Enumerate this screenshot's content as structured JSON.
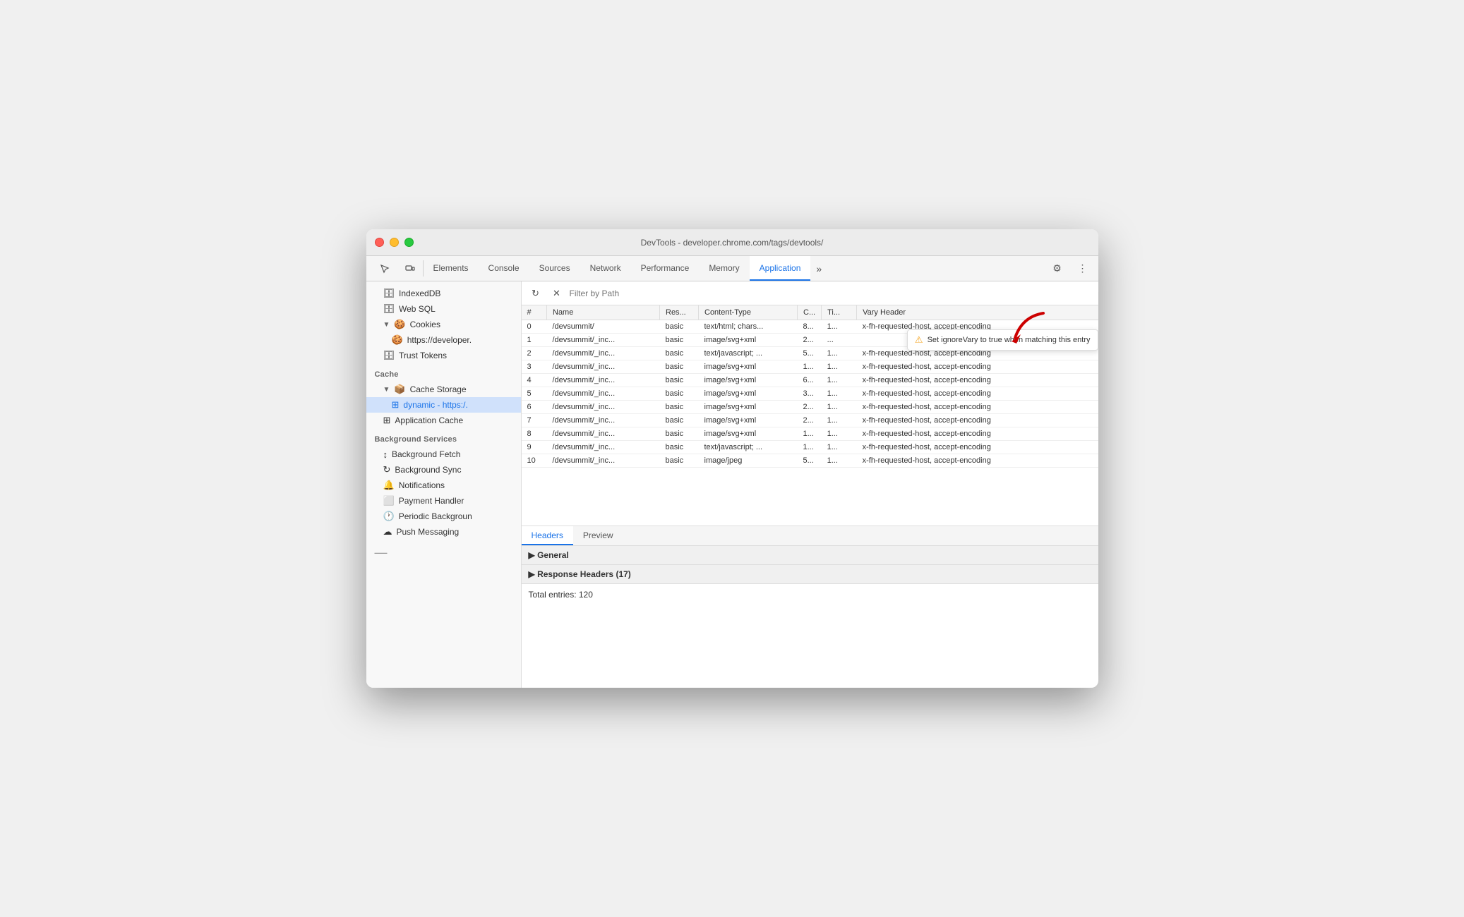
{
  "window": {
    "title": "DevTools - developer.chrome.com/tags/devtools/"
  },
  "tabs": [
    {
      "id": "elements",
      "label": "Elements",
      "active": false
    },
    {
      "id": "console",
      "label": "Console",
      "active": false
    },
    {
      "id": "sources",
      "label": "Sources",
      "active": false
    },
    {
      "id": "network",
      "label": "Network",
      "active": false
    },
    {
      "id": "performance",
      "label": "Performance",
      "active": false
    },
    {
      "id": "memory",
      "label": "Memory",
      "active": false
    },
    {
      "id": "application",
      "label": "Application",
      "active": true
    }
  ],
  "sidebar": {
    "items": [
      {
        "id": "indexeddb",
        "label": "IndexedDB",
        "icon": "🗄",
        "indent": 1,
        "type": "db"
      },
      {
        "id": "websql",
        "label": "Web SQL",
        "icon": "🗄",
        "indent": 1,
        "type": "db"
      },
      {
        "id": "cookies",
        "label": "Cookies",
        "icon": "🍪",
        "indent": 1,
        "type": "expand",
        "expanded": true
      },
      {
        "id": "cookies-https",
        "label": "https://developer.",
        "icon": "🍪",
        "indent": 2
      },
      {
        "id": "trust-tokens",
        "label": "Trust Tokens",
        "icon": "🗄",
        "indent": 1
      }
    ],
    "cache_section": "Cache",
    "cache_items": [
      {
        "id": "cache-storage",
        "label": "Cache Storage",
        "icon": "📦",
        "indent": 1,
        "type": "expand",
        "expanded": true
      },
      {
        "id": "dynamic",
        "label": "dynamic - https:/.",
        "icon": "⊞",
        "indent": 2,
        "selected": true
      },
      {
        "id": "app-cache",
        "label": "Application Cache",
        "icon": "⊞",
        "indent": 1
      }
    ],
    "bg_section": "Background Services",
    "bg_items": [
      {
        "id": "bg-fetch",
        "label": "Background Fetch",
        "icon": "↕",
        "indent": 1
      },
      {
        "id": "bg-sync",
        "label": "Background Sync",
        "icon": "↻",
        "indent": 1
      },
      {
        "id": "notifications",
        "label": "Notifications",
        "icon": "🔔",
        "indent": 1
      },
      {
        "id": "payment-handler",
        "label": "Payment Handler",
        "icon": "⬜",
        "indent": 1
      },
      {
        "id": "periodic-bg",
        "label": "Periodic Backgroun",
        "icon": "🕐",
        "indent": 1
      },
      {
        "id": "push-messaging",
        "label": "Push Messaging",
        "icon": "☁",
        "indent": 1
      }
    ]
  },
  "filter": {
    "placeholder": "Filter by Path"
  },
  "table": {
    "columns": [
      "#",
      "Name",
      "Res...",
      "Content-Type",
      "C...",
      "Ti...",
      "Vary Header"
    ],
    "rows": [
      {
        "hash": "0",
        "name": "/devsummit/",
        "res": "basic",
        "content": "text/html; chars...",
        "c": "8...",
        "ti": "1...",
        "vary": "x-fh-requested-host, accept-encoding",
        "selected": false,
        "tooltip": false
      },
      {
        "hash": "1",
        "name": "/devsummit/_inc...",
        "res": "basic",
        "content": "image/svg+xml",
        "c": "2...",
        "ti": "...",
        "vary": "",
        "selected": false,
        "tooltip": true
      },
      {
        "hash": "2",
        "name": "/devsummit/_inc...",
        "res": "basic",
        "content": "text/javascript; ...",
        "c": "5...",
        "ti": "1...",
        "vary": "x-fh-requested-host, accept-encoding",
        "selected": false,
        "tooltip": false
      },
      {
        "hash": "3",
        "name": "/devsummit/_inc...",
        "res": "basic",
        "content": "image/svg+xml",
        "c": "1...",
        "ti": "1...",
        "vary": "x-fh-requested-host, accept-encoding",
        "selected": false,
        "tooltip": false
      },
      {
        "hash": "4",
        "name": "/devsummit/_inc...",
        "res": "basic",
        "content": "image/svg+xml",
        "c": "6...",
        "ti": "1...",
        "vary": "x-fh-requested-host, accept-encoding",
        "selected": false,
        "tooltip": false
      },
      {
        "hash": "5",
        "name": "/devsummit/_inc...",
        "res": "basic",
        "content": "image/svg+xml",
        "c": "3...",
        "ti": "1...",
        "vary": "x-fh-requested-host, accept-encoding",
        "selected": false,
        "tooltip": false
      },
      {
        "hash": "6",
        "name": "/devsummit/_inc...",
        "res": "basic",
        "content": "image/svg+xml",
        "c": "2...",
        "ti": "1...",
        "vary": "x-fh-requested-host, accept-encoding",
        "selected": false,
        "tooltip": false
      },
      {
        "hash": "7",
        "name": "/devsummit/_inc...",
        "res": "basic",
        "content": "image/svg+xml",
        "c": "2...",
        "ti": "1...",
        "vary": "x-fh-requested-host, accept-encoding",
        "selected": false,
        "tooltip": false
      },
      {
        "hash": "8",
        "name": "/devsummit/_inc...",
        "res": "basic",
        "content": "image/svg+xml",
        "c": "1...",
        "ti": "1...",
        "vary": "x-fh-requested-host, accept-encoding",
        "selected": false,
        "tooltip": false
      },
      {
        "hash": "9",
        "name": "/devsummit/_inc...",
        "res": "basic",
        "content": "text/javascript; ...",
        "c": "1...",
        "ti": "1...",
        "vary": "x-fh-requested-host, accept-encoding",
        "selected": false,
        "tooltip": false
      },
      {
        "hash": "10",
        "name": "/devsummit/_inc...",
        "res": "basic",
        "content": "image/jpeg",
        "c": "5...",
        "ti": "1...",
        "vary": "x-fh-requested-host, accept-encoding",
        "selected": false,
        "tooltip": false
      }
    ],
    "tooltip_text": "Set ignoreVary to true when matching this entry"
  },
  "bottom_panel": {
    "tabs": [
      {
        "id": "headers",
        "label": "Headers",
        "active": true
      },
      {
        "id": "preview",
        "label": "Preview",
        "active": false
      }
    ],
    "sections": [
      {
        "id": "general",
        "label": "▶ General"
      },
      {
        "id": "response-headers",
        "label": "▶ Response Headers (17)"
      }
    ],
    "total_entries": "Total entries: 120"
  }
}
